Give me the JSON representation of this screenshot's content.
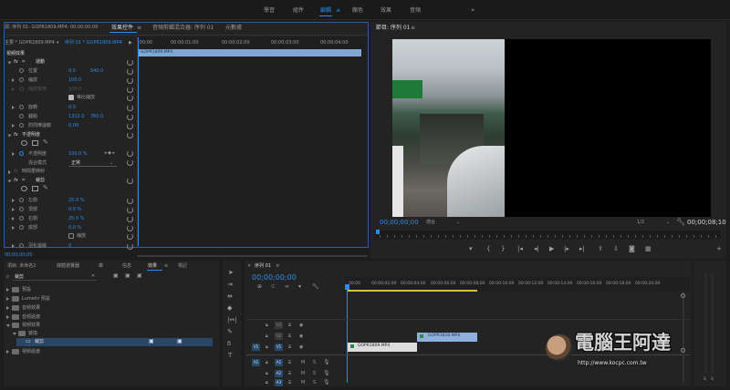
{
  "workspace_tabs": [
    "學習",
    "組件",
    "編輯",
    "顏色",
    "效果",
    "音頻"
  ],
  "workspace_more": "»",
  "workspace_menu": "≡",
  "source_panel": {
    "title_fragment": "源: 序列 01: GOPR1809.MP4: 00;00;00;00",
    "tabs": [
      "效果控件",
      "音頻剪輯混合器: 序列 01",
      "元數據"
    ],
    "tab_menu": "≡",
    "master_clip": "主要 * GOPR1809.MP4",
    "sequence_clip": "序列 01 * GOPR1809.MP4",
    "ruler_start": ";00;00",
    "ruler_ticks": [
      "00;00;01;00",
      "00;00;02;00",
      "00;00;03;00",
      "00;00;04;00"
    ],
    "clip_bar": "GOPR1809.MP4",
    "section_video": "視頻效果",
    "motion": "運動",
    "position": {
      "label": "位置",
      "x": "0.0",
      "y": "540.0"
    },
    "scale": {
      "label": "縮放",
      "value": "100.0"
    },
    "scale_width": {
      "label": "縮放寬度",
      "value": "100.0"
    },
    "uniform_scale": "等比縮放",
    "rotation": {
      "label": "旋轉",
      "value": "0.0"
    },
    "anchor": {
      "label": "錨點",
      "x": "1312.0",
      "y": "760.0"
    },
    "antiflicker": {
      "label": "防閃爍濾鏡",
      "value": "0.00"
    },
    "opacity_section": "不透明度",
    "opacity": {
      "label": "不透明度",
      "value": "100.0 %"
    },
    "blend": {
      "label": "混合模式",
      "value": "正常"
    },
    "time_remap": "時間重映射",
    "crop_section": "裁剪",
    "left": {
      "label": "左側",
      "value": "25.0 %"
    },
    "top": {
      "label": "頂部",
      "value": "0.0 %"
    },
    "right": {
      "label": "右側",
      "value": "25.0 %"
    },
    "bottom": {
      "label": "底部",
      "value": "0.0 %"
    },
    "zoom": "縮放",
    "feather": {
      "label": "羽化邊緣",
      "value": "0"
    },
    "timecode": "00;00;00;00"
  },
  "program": {
    "title": "節目: 序列 01",
    "timecode_left": "00;00;00;00",
    "fit": "適合",
    "resolution": "1/2",
    "timecode_right": "00;00;08;10"
  },
  "project": {
    "tabs": [
      "項目: 未命名2",
      "媒體瀏覽器",
      "庫",
      "信息",
      "效果",
      "標記"
    ],
    "search_placeholder": "裁剪",
    "tree": [
      "預設",
      "Lumetri 預設",
      "音頻效果",
      "音頻過渡",
      "視頻效果",
      "變換",
      "裁剪",
      "視頻過渡"
    ]
  },
  "timeline": {
    "title": "序列 01",
    "timecode": "00;00;00;00",
    "ruler": [
      "00;00",
      "00;00;02;00",
      "00;00;04;00",
      "00;00;06;00",
      "00;00;08;00",
      "00;00;10;00",
      "00;00;12;00",
      "00;00;14;00",
      "00;00;16;00",
      "00;00;18;00",
      "00;00;20;00"
    ],
    "video_tracks": [
      "V3",
      "V2",
      "V1"
    ],
    "audio_tracks": [
      "A1",
      "A2",
      "A3"
    ],
    "source_v": "V1",
    "source_a": "A1",
    "clip_v1": "GOPR1809.MP4",
    "clip_v2": "GOPR1810.MP4",
    "track_toggles": [
      "M",
      "S"
    ]
  },
  "watermark": {
    "name": "電腦王阿達",
    "url": "http://www.kocpc.com.tw"
  },
  "audio_meter": [
    "S",
    "S"
  ]
}
